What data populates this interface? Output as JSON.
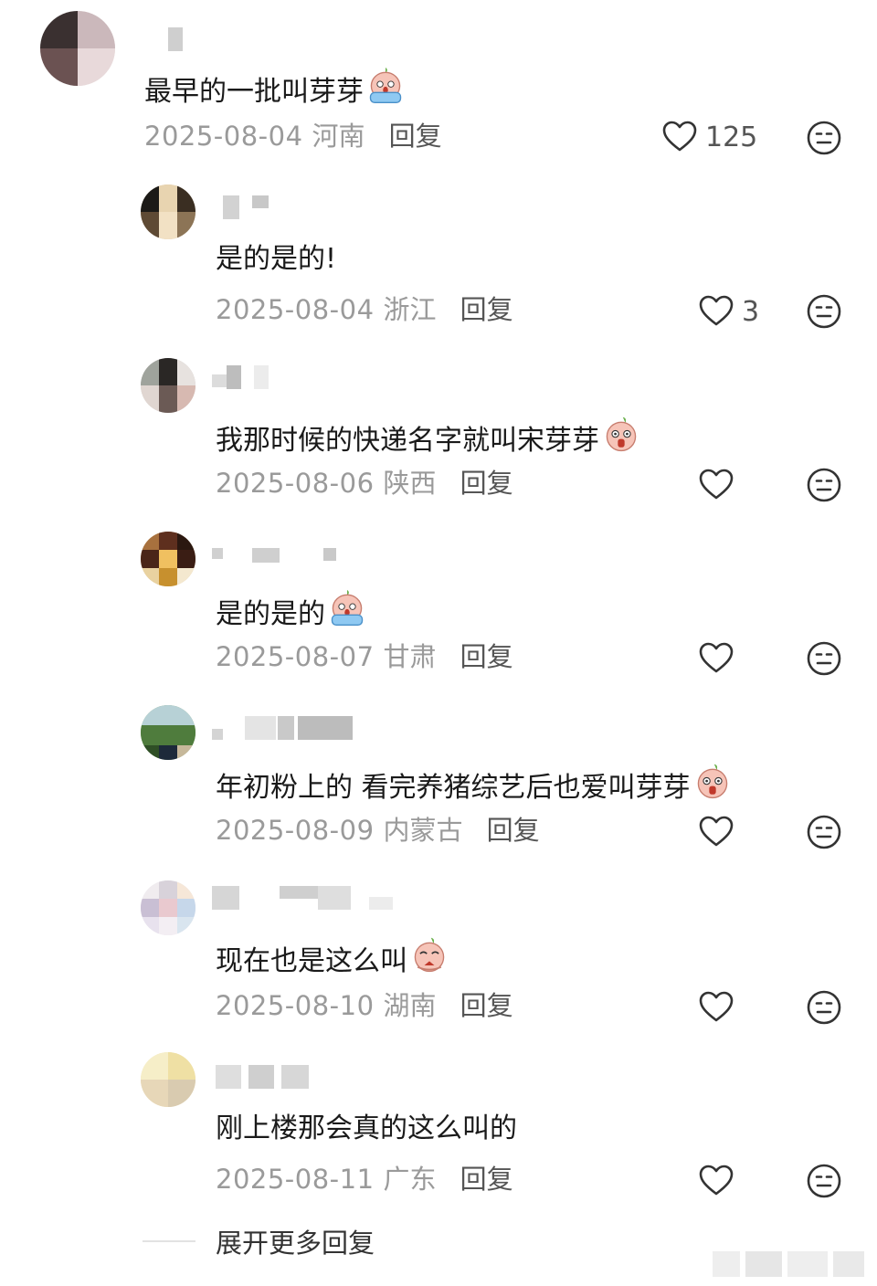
{
  "thread": {
    "main": {
      "text": "最早的一批叫芽芽",
      "date": "2025-08-04",
      "location": "河南",
      "reply_label": "回复",
      "likes": "125"
    },
    "replies": [
      {
        "text": "是的是的!",
        "date": "2025-08-04",
        "location": "浙江",
        "reply_label": "回复",
        "likes": "3"
      },
      {
        "text": "我那时候的快递名字就叫宋芽芽",
        "date": "2025-08-06",
        "location": "陕西",
        "reply_label": "回复",
        "likes": ""
      },
      {
        "text": "是的是的",
        "date": "2025-08-07",
        "location": "甘肃",
        "reply_label": "回复",
        "likes": ""
      },
      {
        "text": "年初粉上的 看完养猪综艺后也爱叫芽芽",
        "date": "2025-08-09",
        "location": "内蒙古",
        "reply_label": "回复",
        "likes": ""
      },
      {
        "text": "现在也是这么叫",
        "date": "2025-08-10",
        "location": "湖南",
        "reply_label": "回复",
        "likes": ""
      },
      {
        "text": "刚上楼那会真的这么叫的",
        "date": "2025-08-11",
        "location": "广东",
        "reply_label": "回复",
        "likes": ""
      }
    ],
    "expand_label": "展开更多回复"
  },
  "icons": {
    "like": "heart-outline-icon",
    "dislike": "neutral-face-icon",
    "emoji_crying": "crying-bean-emoji",
    "emoji_shocked": "shocked-bean-emoji",
    "emoji_pleading": "pleading-bean-emoji"
  },
  "colors": {
    "meta_text": "#9a9a9a",
    "reply_text": "#555555",
    "icon_stroke": "#333333"
  }
}
